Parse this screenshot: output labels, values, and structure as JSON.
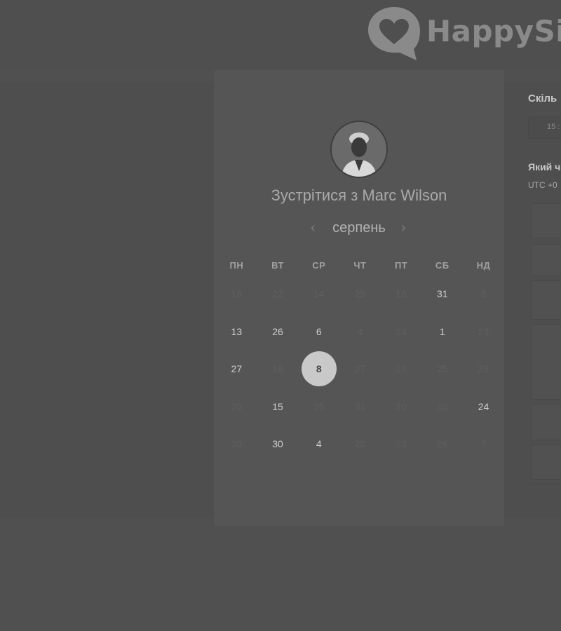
{
  "brand": {
    "name": "HappySig"
  },
  "meeting": {
    "title": "Зустрітися з Marc Wilson",
    "month": "серпень",
    "prev_icon": "‹",
    "next_icon": "›"
  },
  "calendar": {
    "weekdays": [
      "ПН",
      "ВТ",
      "СР",
      "ЧТ",
      "ПТ",
      "СБ",
      "НД"
    ],
    "weeks": [
      [
        {
          "d": "18",
          "s": "off"
        },
        {
          "d": "22",
          "s": "off"
        },
        {
          "d": "14",
          "s": "off"
        },
        {
          "d": "29",
          "s": "off"
        },
        {
          "d": "16",
          "s": "off"
        },
        {
          "d": "31",
          "s": "on"
        },
        {
          "d": "6",
          "s": "off"
        }
      ],
      [
        {
          "d": "13",
          "s": "on"
        },
        {
          "d": "26",
          "s": "on"
        },
        {
          "d": "6",
          "s": "on"
        },
        {
          "d": "4",
          "s": "off"
        },
        {
          "d": "24",
          "s": "off"
        },
        {
          "d": "1",
          "s": "on"
        },
        {
          "d": "23",
          "s": "off"
        }
      ],
      [
        {
          "d": "27",
          "s": "on"
        },
        {
          "d": "16",
          "s": "off"
        },
        {
          "d": "8",
          "s": "sel"
        },
        {
          "d": "27",
          "s": "off"
        },
        {
          "d": "19",
          "s": "off"
        },
        {
          "d": "25",
          "s": "off"
        },
        {
          "d": "23",
          "s": "off"
        }
      ],
      [
        {
          "d": "20",
          "s": "off"
        },
        {
          "d": "15",
          "s": "on"
        },
        {
          "d": "25",
          "s": "off"
        },
        {
          "d": "31",
          "s": "off"
        },
        {
          "d": "20",
          "s": "off"
        },
        {
          "d": "10",
          "s": "off"
        },
        {
          "d": "24",
          "s": "on"
        }
      ],
      [
        {
          "d": "30",
          "s": "off"
        },
        {
          "d": "30",
          "s": "on"
        },
        {
          "d": "4",
          "s": "on"
        },
        {
          "d": "22",
          "s": "off"
        },
        {
          "d": "23",
          "s": "off"
        },
        {
          "d": "26",
          "s": "off"
        },
        {
          "d": "7",
          "s": "off"
        }
      ]
    ]
  },
  "side": {
    "duration_question": "Скіль",
    "duration_value": "15 :",
    "time_question": "Який ч",
    "timezone": "UTC +0"
  },
  "colors": {
    "selected_day": "#c9c9c9",
    "background": "#505050",
    "card": "#555555"
  }
}
